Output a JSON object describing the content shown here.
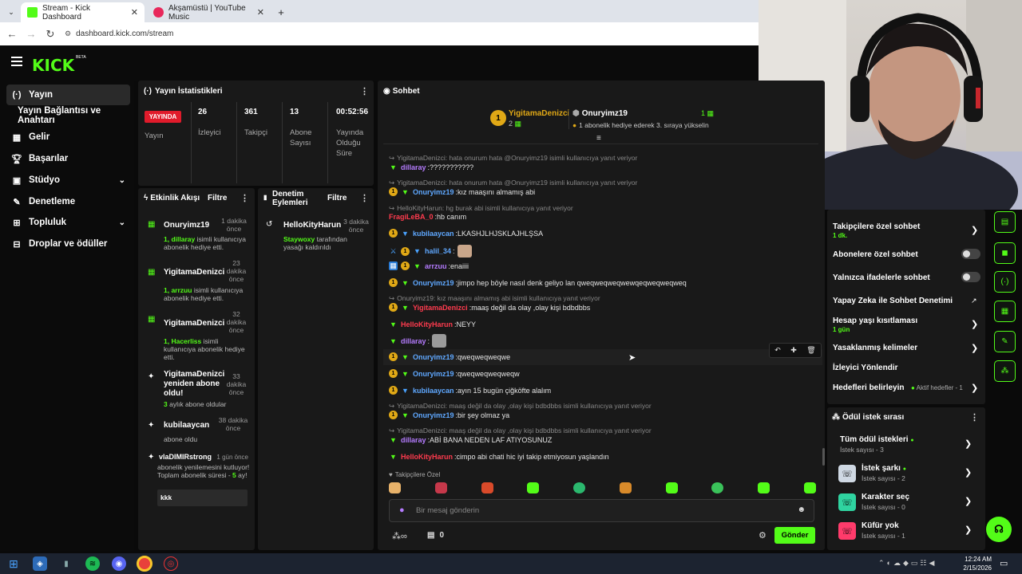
{
  "browser": {
    "tabs": [
      {
        "title": "Stream - Kick Dashboard",
        "active": true
      },
      {
        "title": "Akşamüstü | YouTube Music",
        "active": false
      }
    ],
    "url": "dashboard.kick.com/stream"
  },
  "header": {
    "logo": "KICK",
    "beta": "BETA"
  },
  "sidebar": {
    "items": [
      {
        "label": "Yayın",
        "icon": "broadcast-icon"
      },
      {
        "label": "Yayın Bağlantısı ve Anahtarı",
        "icon": ""
      },
      {
        "label": "Gelir",
        "icon": "revenue-icon"
      },
      {
        "label": "Başarılar",
        "icon": "trophy-icon"
      },
      {
        "label": "Stüdyo",
        "icon": "studio-icon"
      },
      {
        "label": "Denetleme",
        "icon": "wrench-icon"
      },
      {
        "label": "Topluluk",
        "icon": "community-icon"
      },
      {
        "label": "Droplar ve ödüller",
        "icon": "gift-icon"
      }
    ]
  },
  "stats": {
    "title": "Yayın İstatistikleri",
    "live_badge": "YAYINDA",
    "live_label": "Yayın",
    "viewers": "26",
    "viewers_label": "İzleyici",
    "followers": "361",
    "followers_label": "Takipçi",
    "subs": "13",
    "subs_label": "Abone Sayısı",
    "uptime": "00:52:56",
    "uptime_label": "Yayında Olduğu Süre"
  },
  "activity": {
    "title": "Etkinlik Akışı",
    "filter": "Filtre",
    "items": [
      {
        "name": "Onuryimz19",
        "time": "1 dakika önce",
        "highlight": "1, dillaray",
        "text": "isimli kullanıcıya abonelik hediye etti."
      },
      {
        "name": "YigitamaDenizci",
        "time": "23 dakika önce",
        "highlight": "1, arrzuu",
        "text": "isimli kullanıcıya abonelik hediye etti."
      },
      {
        "name": "YigitamaDenizci",
        "time": "32 dakika önce",
        "highlight": "1, Hacerliss",
        "text": "isimli kullanıcıya abonelik hediye etti."
      },
      {
        "name": "YigitamaDenizci yeniden abone oldu!",
        "time": "33 dakika önce",
        "highlight": "3",
        "text": "aylık abone oldular"
      },
      {
        "name": "kubilaaycan",
        "time": "38 dakika önce",
        "highlight": "",
        "text": "abone oldu"
      },
      {
        "name": "vlaDIMIRstrong",
        "time": "1 gün önce",
        "highlight": "5",
        "text": "abonelik yenilemesini kutluyor! Toplam abonelik süresi -",
        "suffix": "ay!",
        "message": "kkk"
      }
    ]
  },
  "moderation": {
    "title": "Denetim Eylemleri",
    "filter": "Filtre",
    "items": [
      {
        "name": "HelloKityHarun",
        "time": "3 dakika önce",
        "highlight": "Staywoxy",
        "text": "tarafından yasağı kaldırıldı"
      }
    ]
  },
  "chat": {
    "title": "Sohbet",
    "pinned": [
      {
        "name": "YigitamaDenizci",
        "count": "2"
      },
      {
        "name": "Onuryimz19",
        "count": "1",
        "text": "1 abonelik hediye ederek 3. sıraya yükselin"
      }
    ],
    "messages": [
      {
        "type": "reply",
        "text": "YigitamaDenizci: hata onurum hata @Onuryimz19 isimli kullanıcıya yanıt veriyor"
      },
      {
        "type": "msg",
        "user": "dillaray",
        "color": "#b57cff",
        "text": "???????????"
      },
      {
        "type": "reply",
        "text": "YigitamaDenizci: hata onurum hata @Onuryimz19 isimli kullanıcıya yanıt veriyor"
      },
      {
        "type": "msg",
        "user": "Onuryimz19",
        "color": "#5fa8ff",
        "text": "kız maaşını almamış abi"
      },
      {
        "type": "reply",
        "text": "HelloKityHarun: hg burak abi isimli kullanıcıya yanıt veriyor"
      },
      {
        "type": "msg",
        "user": "FragiLeBA_0",
        "color": "#ff3b4e",
        "text": "hb canım"
      },
      {
        "type": "msg",
        "user": "kubilaaycan",
        "color": "#5fa8ff",
        "text": "LKASHJLHJSKLAJHLŞSA"
      },
      {
        "type": "msg",
        "user": "halil_34",
        "color": "#5fa8ff",
        "text": ""
      },
      {
        "type": "msg",
        "user": "arrzuu",
        "color": "#b57cff",
        "text": "enaiiii"
      },
      {
        "type": "msg",
        "user": "Onuryimz19",
        "color": "#5fa8ff",
        "text": "jimpo hep böyle nasıl denk geliyo lan qweqweqweqwewqeqweqweqweq"
      },
      {
        "type": "reply",
        "text": "Onuryimz19: kız maaşını almamış abi isimli kullanıcıya yanıt veriyor"
      },
      {
        "type": "msg",
        "user": "YigitamaDenizci",
        "color": "#ff3b4e",
        "text": "maaş değil da olay ,olay kişi bdbdbbs"
      },
      {
        "type": "msg",
        "user": "HelloKityHarun",
        "color": "#ff3b4e",
        "text": "NEYY"
      },
      {
        "type": "msg",
        "user": "dillaray",
        "color": "#b57cff",
        "text": ""
      },
      {
        "type": "msg",
        "user": "Onuryimz19",
        "color": "#5fa8ff",
        "text": "qweqweqweqwe"
      },
      {
        "type": "msg",
        "user": "Onuryimz19",
        "color": "#5fa8ff",
        "text": "qweqweqweqweqw"
      },
      {
        "type": "msg",
        "user": "kubilaaycan",
        "color": "#5fa8ff",
        "text": "ayın 15 bugün çiğköfte alalım"
      },
      {
        "type": "reply",
        "text": "YigitamaDenizci: maaş değil da olay ,olay kişi bdbdbbs isimli kullanıcıya yanıt veriyor"
      },
      {
        "type": "msg",
        "user": "Onuryimz19",
        "color": "#5fa8ff",
        "text": "bir şey olmaz ya"
      },
      {
        "type": "reply",
        "text": "YigitamaDenizci: maaş değil da olay ,olay kişi bdbdbbs isimli kullanıcıya yanıt veriyor"
      },
      {
        "type": "msg",
        "user": "dillaray",
        "color": "#b57cff",
        "text": "ABİ BANA NEDEN LAF ATIYOSUNUZ"
      },
      {
        "type": "msg",
        "user": "HelloKityHarun",
        "color": "#ff3b4e",
        "text": "cimpo abi chati hic iyi takip etmiyosun yaşlandın"
      }
    ],
    "followers_only": "Takipçilere Özel",
    "placeholder": "Bir mesaj gönderin",
    "points": "0",
    "send": "Gönder"
  },
  "chat_settings": {
    "items": [
      {
        "label": "Takipçilere özel sohbet",
        "sub": "1 dk."
      },
      {
        "label": "Abonelere özel sohbet"
      },
      {
        "label": "Yalnızca ifadelerle sohbet"
      },
      {
        "label": "Yapay Zeka ile Sohbet Denetimi"
      },
      {
        "label": "Hesap yaşı kısıtlaması",
        "sub": "1 gün"
      },
      {
        "label": "Yasaklanmış kelimeler"
      },
      {
        "label": "İzleyici Yönlendir"
      },
      {
        "label": "Hedefleri belirleyin",
        "sub": "Aktif hedefler - 1"
      }
    ]
  },
  "rewards": {
    "title": "Ödül istek sırası",
    "items": [
      {
        "title": "Tüm ödül istekleri",
        "count": "İstek sayısı - 3"
      },
      {
        "title": "İstek şarkı",
        "count": "İstek sayısı - 2",
        "color": "#cfd8e3"
      },
      {
        "title": "Karakter seç",
        "count": "İstek sayısı - 0",
        "color": "#2fd3a0"
      },
      {
        "title": "Küfür yok",
        "count": "İstek sayısı - 1",
        "color": "#ff3b6b"
      }
    ]
  },
  "taskbar": {
    "time": "12:24 AM",
    "date": "2/15/2026"
  },
  "colors": {
    "accent": "#53fc18",
    "panel": "#191919",
    "bg": "#0a0a0a"
  }
}
